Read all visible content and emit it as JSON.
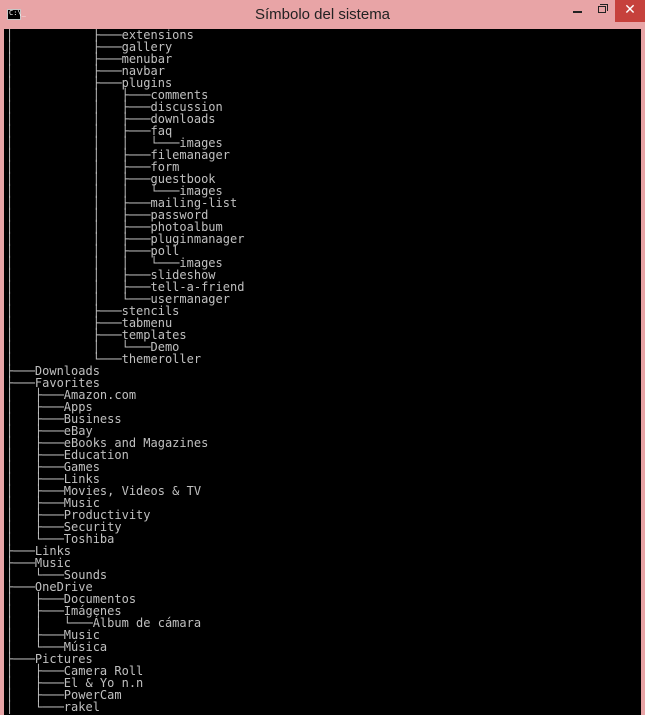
{
  "window": {
    "title": "Símbolo del sistema",
    "icon": "console-icon",
    "icon_text": "C:\\_",
    "controls": {
      "minimize": "minimize-icon",
      "maximize": "maximize-icon",
      "close": "close-icon",
      "close_glyph": "✕"
    },
    "colors": {
      "frame": "#e8a4a6",
      "close": "#c6413c",
      "console_bg": "#000000",
      "console_text": "#c0c0c0"
    }
  },
  "console": {
    "lines": [
      "│           ├───extensions",
      "│           ├───gallery",
      "│           ├───menubar",
      "│           ├───navbar",
      "│           ├───plugins",
      "│           │   ├───comments",
      "│           │   ├───discussion",
      "│           │   ├───downloads",
      "│           │   ├───faq",
      "│           │   │   └───images",
      "│           │   ├───filemanager",
      "│           │   ├───form",
      "│           │   ├───guestbook",
      "│           │   │   └───images",
      "│           │   ├───mailing-list",
      "│           │   ├───password",
      "│           │   ├───photoalbum",
      "│           │   ├───pluginmanager",
      "│           │   ├───poll",
      "│           │   │   └───images",
      "│           │   ├───slideshow",
      "│           │   ├───tell-a-friend",
      "│           │   └───usermanager",
      "│           ├───stencils",
      "│           ├───tabmenu",
      "│           ├───templates",
      "│           │   └───Demo",
      "│           └───themeroller",
      "├───Downloads",
      "├───Favorites",
      "│   ├───Amazon.com",
      "│   ├───Apps",
      "│   ├───Business",
      "│   ├───eBay",
      "│   ├───eBooks and Magazines",
      "│   ├───Education",
      "│   ├───Games",
      "│   ├───Links",
      "│   ├───Movies, Videos & TV",
      "│   ├───Music",
      "│   ├───Productivity",
      "│   ├───Security",
      "│   └───Toshiba",
      "├───Links",
      "├───Music",
      "│   └───Sounds",
      "├───OneDrive",
      "│   ├───Documentos",
      "│   ├───Imágenes",
      "│   │   └───Álbum de cámara",
      "│   ├───Music",
      "│   └───Música",
      "├───Pictures",
      "│   ├───Camera Roll",
      "│   ├───El & Yo n.n",
      "│   ├───PowerCam",
      "│   └───rakel"
    ]
  }
}
